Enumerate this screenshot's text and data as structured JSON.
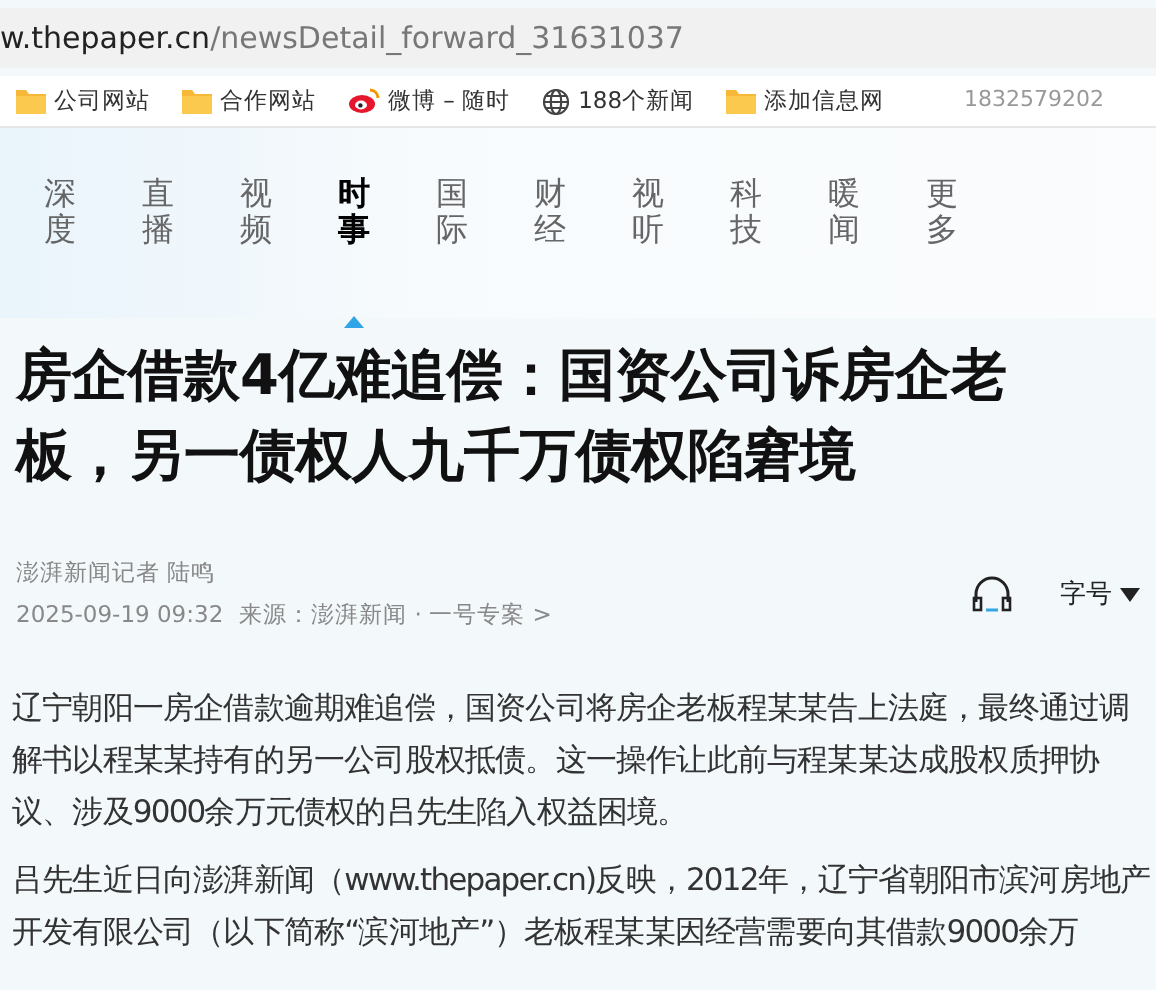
{
  "address_bar": {
    "host": "w.thepaper.cn",
    "path": "/newsDetail_forward_31631037"
  },
  "bookmarks": [
    {
      "kind": "folder",
      "label": "公司网站"
    },
    {
      "kind": "folder",
      "label": "合作网站"
    },
    {
      "kind": "weibo",
      "label": "微博 – 随时"
    },
    {
      "kind": "globe",
      "label": "188个新闻"
    },
    {
      "kind": "folder",
      "label": "添加信息网"
    }
  ],
  "bookmarks_extra": "1832579202",
  "nav": [
    {
      "label": "深度",
      "selected": false
    },
    {
      "label": "直播",
      "selected": false
    },
    {
      "label": "视频",
      "selected": false
    },
    {
      "label": "时事",
      "selected": true
    },
    {
      "label": "国际",
      "selected": false
    },
    {
      "label": "财经",
      "selected": false
    },
    {
      "label": "视听",
      "selected": false
    },
    {
      "label": "科技",
      "selected": false
    },
    {
      "label": "暖闻",
      "selected": false
    },
    {
      "label": "更多",
      "selected": false
    }
  ],
  "article": {
    "title": "房企借款4亿难追偿：国资公司诉房企老板，另一债权人九千万债权陷窘境",
    "byline": "澎湃新闻记者 陆鸣",
    "date": "2025-09-19 09:32",
    "source": "来源：澎湃新闻 · 一号专案 >",
    "font_size_label": "字号",
    "paragraphs": [
      "辽宁朝阳一房企借款逾期难追偿，国资公司将房企老板程某某告上法庭，最终通过调解书以程某某持有的另一公司股权抵债。这一操作让此前与程某某达成股权质押协议、涉及9000余万元债权的吕先生陷入权益困境。",
      "吕先生近日向澎湃新闻（www.thepaper.cn)反映，2012年，辽宁省朝阳市滨河房地产开发有限公司（以下简称“滨河地产”）老板程某某因经营需要向其借款9000余万"
    ]
  }
}
